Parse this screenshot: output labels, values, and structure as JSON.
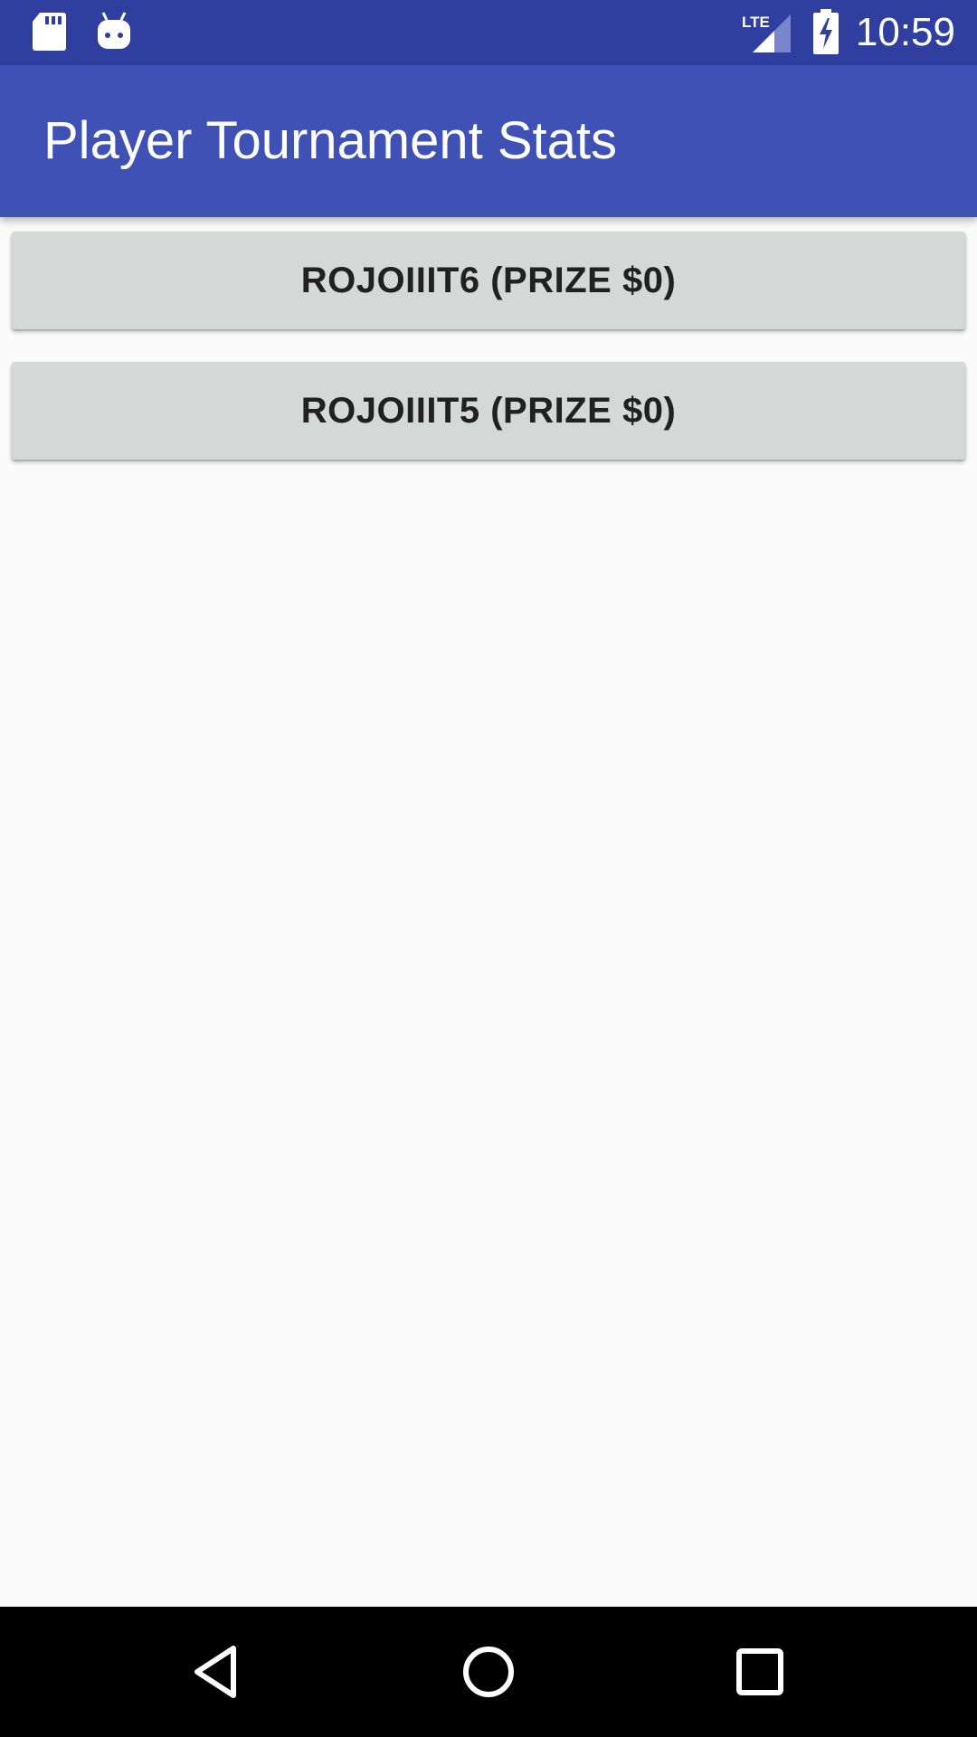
{
  "status_bar": {
    "time": "10:59",
    "network": "LTE",
    "icons": [
      "sd-card-icon",
      "android-robot-icon",
      "lte-signal-icon",
      "battery-charging-icon"
    ]
  },
  "app_bar": {
    "title": "Player Tournament Stats"
  },
  "tournaments": [
    {
      "label": "ROJOIIIT6 (PRIZE $0)"
    },
    {
      "label": "ROJOIIIT5 (PRIZE $0)"
    }
  ],
  "nav_bar": {
    "icons": [
      "back-icon",
      "home-icon",
      "recents-icon"
    ]
  },
  "colors": {
    "status_bar": "#303f9f",
    "app_bar": "#3f51b5",
    "background": "#fafafa",
    "button": "#d6d7d7"
  }
}
